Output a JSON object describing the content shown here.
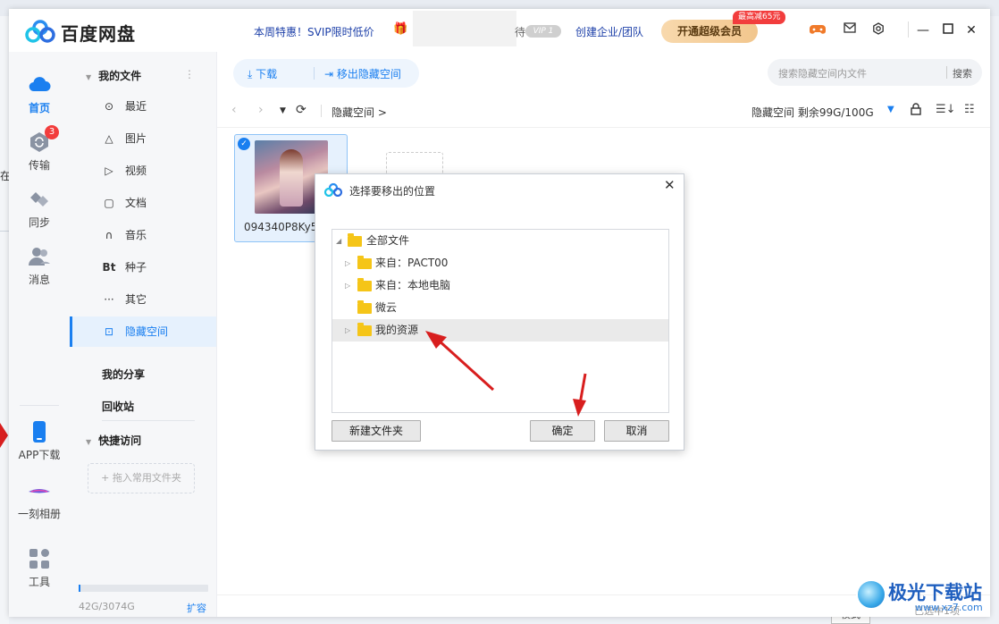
{
  "app": {
    "name": "百度网盘"
  },
  "header": {
    "promo": "本周特惠！SVIP限时低价",
    "vip_tail": "待",
    "vip_badge": "VIP 1",
    "enterprise": "创建企业/团队",
    "svip_button": "开通超级会员",
    "svip_tag": "最高减65元"
  },
  "nav": {
    "items": [
      {
        "label": "首页",
        "icon": "cloud-icon"
      },
      {
        "label": "传输",
        "icon": "transfer-icon",
        "badge": "3"
      },
      {
        "label": "同步",
        "icon": "sync-icon"
      },
      {
        "label": "消息",
        "icon": "message-icon"
      }
    ],
    "bottom": [
      {
        "label": "APP下载",
        "icon": "phone-icon"
      },
      {
        "label": "一刻相册",
        "icon": "album-icon"
      },
      {
        "label": "工具",
        "icon": "tools-icon"
      }
    ]
  },
  "sidebar": {
    "my_files": "我的文件",
    "items": [
      {
        "label": "最近",
        "icon": "⊙"
      },
      {
        "label": "图片",
        "icon": "△"
      },
      {
        "label": "视频",
        "icon": "▷"
      },
      {
        "label": "文档",
        "icon": "▢"
      },
      {
        "label": "音乐",
        "icon": "∩"
      },
      {
        "label": "种子",
        "icon": "Bt"
      },
      {
        "label": "其它",
        "icon": "···"
      },
      {
        "label": "隐藏空间",
        "icon": "⊡"
      }
    ],
    "my_share": "我的分享",
    "recycle": "回收站",
    "quick_access": "快捷访问",
    "quick_add": "+ 拖入常用文件夹",
    "storage": "42G/3074G",
    "storage_fraction": 0.014,
    "expand": "扩容"
  },
  "toolbar": {
    "download": "下载",
    "move_out": "移出隐藏空间",
    "search_placeholder": "搜索隐藏空间内文件",
    "search_button": "搜索"
  },
  "breadcrumb": {
    "path": "隐藏空间",
    "quota": "隐藏空间 剩余99G/100G"
  },
  "files": [
    {
      "name": "094340P8Ky5"
    }
  ],
  "status": {
    "text": "已选中1项"
  },
  "dialog": {
    "title": "选择要移出的位置",
    "tree": [
      {
        "label": "全部文件",
        "level": 0,
        "expanded": true
      },
      {
        "label": "来自：PACT00",
        "level": 1
      },
      {
        "label": "来自：本地电脑",
        "level": 1
      },
      {
        "label": "微云",
        "level": 1,
        "leaf": true
      },
      {
        "label": "我的资源",
        "level": 1,
        "selected": true
      }
    ],
    "new_folder": "新建文件夹",
    "confirm": "确定",
    "cancel": "取消"
  },
  "background": {
    "left_fragment": "在",
    "bottom_fragment": "模式"
  },
  "watermark": {
    "text": "极光下载站",
    "url": "www.xz7.com"
  },
  "colors": {
    "accent": "#1a7ff0",
    "annotation_arrow": "#d81e1e"
  }
}
